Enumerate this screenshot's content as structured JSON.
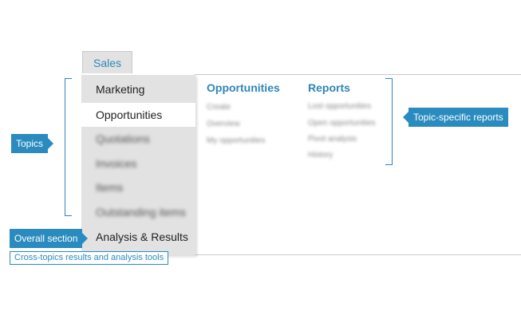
{
  "tab": {
    "label": "Sales"
  },
  "sidebar": {
    "items": [
      {
        "label": "Marketing"
      },
      {
        "label": "Opportunities"
      },
      {
        "label": "Quotations"
      },
      {
        "label": "Invoices"
      },
      {
        "label": "Items"
      },
      {
        "label": "Outstanding items"
      },
      {
        "label": "Analysis & Results"
      }
    ],
    "active_index": 1
  },
  "columns": {
    "opportunities": {
      "title": "Opportunities",
      "items": [
        "Create",
        "Overview",
        "My opportunities"
      ]
    },
    "reports": {
      "title": "Reports",
      "items": [
        "Lost opportunities",
        "Open opportunities",
        "Pivot analysis",
        "History"
      ]
    }
  },
  "callouts": {
    "topics": "Topics",
    "topic_reports": "Topic-specific reports",
    "overall_section": "Overall section",
    "cross_topics": "Cross-topics results and analysis tools"
  },
  "colors": {
    "accent": "#2a8bbf",
    "menu_bg": "#e2e2e2",
    "active_bg": "#ffffff"
  }
}
